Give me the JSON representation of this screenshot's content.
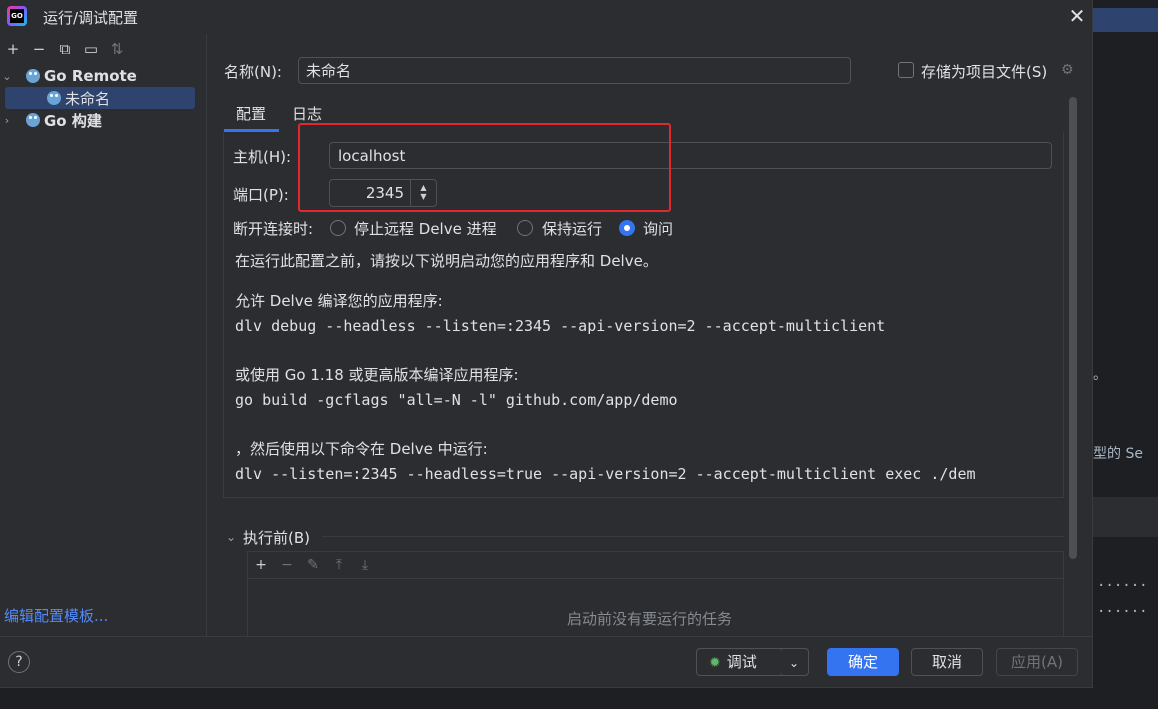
{
  "window": {
    "title": "运行/调试配置"
  },
  "background_editor": {
    "lines": [
      "。",
      "型的 Se",
      "......",
      "......"
    ]
  },
  "left_panel": {
    "toolbar_icons": [
      "add-icon",
      "remove-icon",
      "copy-icon",
      "folder-icon",
      "sort-icon"
    ],
    "tree": [
      {
        "label": "Go Remote",
        "expanded": true,
        "bold": true
      },
      {
        "label": "未命名",
        "selected": true
      },
      {
        "label": "Go 构建",
        "expanded": false,
        "bold": true
      }
    ],
    "edit_templates": "编辑配置模板..."
  },
  "form": {
    "name_label": "名称(N):",
    "name_value": "未命名",
    "store_label": "存储为项目文件(S)",
    "store_checked": false,
    "tabs": [
      {
        "label": "配置",
        "active": true
      },
      {
        "label": "日志",
        "active": false
      }
    ],
    "host_label": "主机(H):",
    "host_value": "localhost",
    "port_label": "端口(P):",
    "port_value": "2345",
    "disconnect_label": "断开连接时:",
    "disconnect_options": [
      {
        "label": "停止远程 Delve 进程",
        "checked": false
      },
      {
        "label": "保持运行",
        "checked": false
      },
      {
        "label": "询问",
        "checked": true
      }
    ],
    "instructions": "在运行此配置之前，请按以下说明启动您的应用程序和 Delve。",
    "allow_label": "允许 Delve 编译您的应用程序:",
    "allow_cmd": "dlv debug --headless --listen=:2345 --api-version=2 --accept-multiclient",
    "or_label": "或使用 Go 1.18 或更高版本编译应用程序:",
    "or_cmd": "go build -gcflags \"all=-N -l\" github.com/app/demo",
    "then_label": "，然后使用以下命令在 Delve 中运行:",
    "then_cmd": "dlv --listen=:2345 --headless=true --api-version=2 --accept-multiclient exec ./dem"
  },
  "before_launch": {
    "label": "执行前(B)",
    "empty_text": "启动前没有要运行的任务"
  },
  "footer": {
    "help": "?",
    "debug": "调试",
    "ok": "确定",
    "cancel": "取消",
    "apply": "应用(A)"
  },
  "colors": {
    "accent": "#3574f0",
    "highlight_box": "#e0282e",
    "link": "#548af7"
  }
}
